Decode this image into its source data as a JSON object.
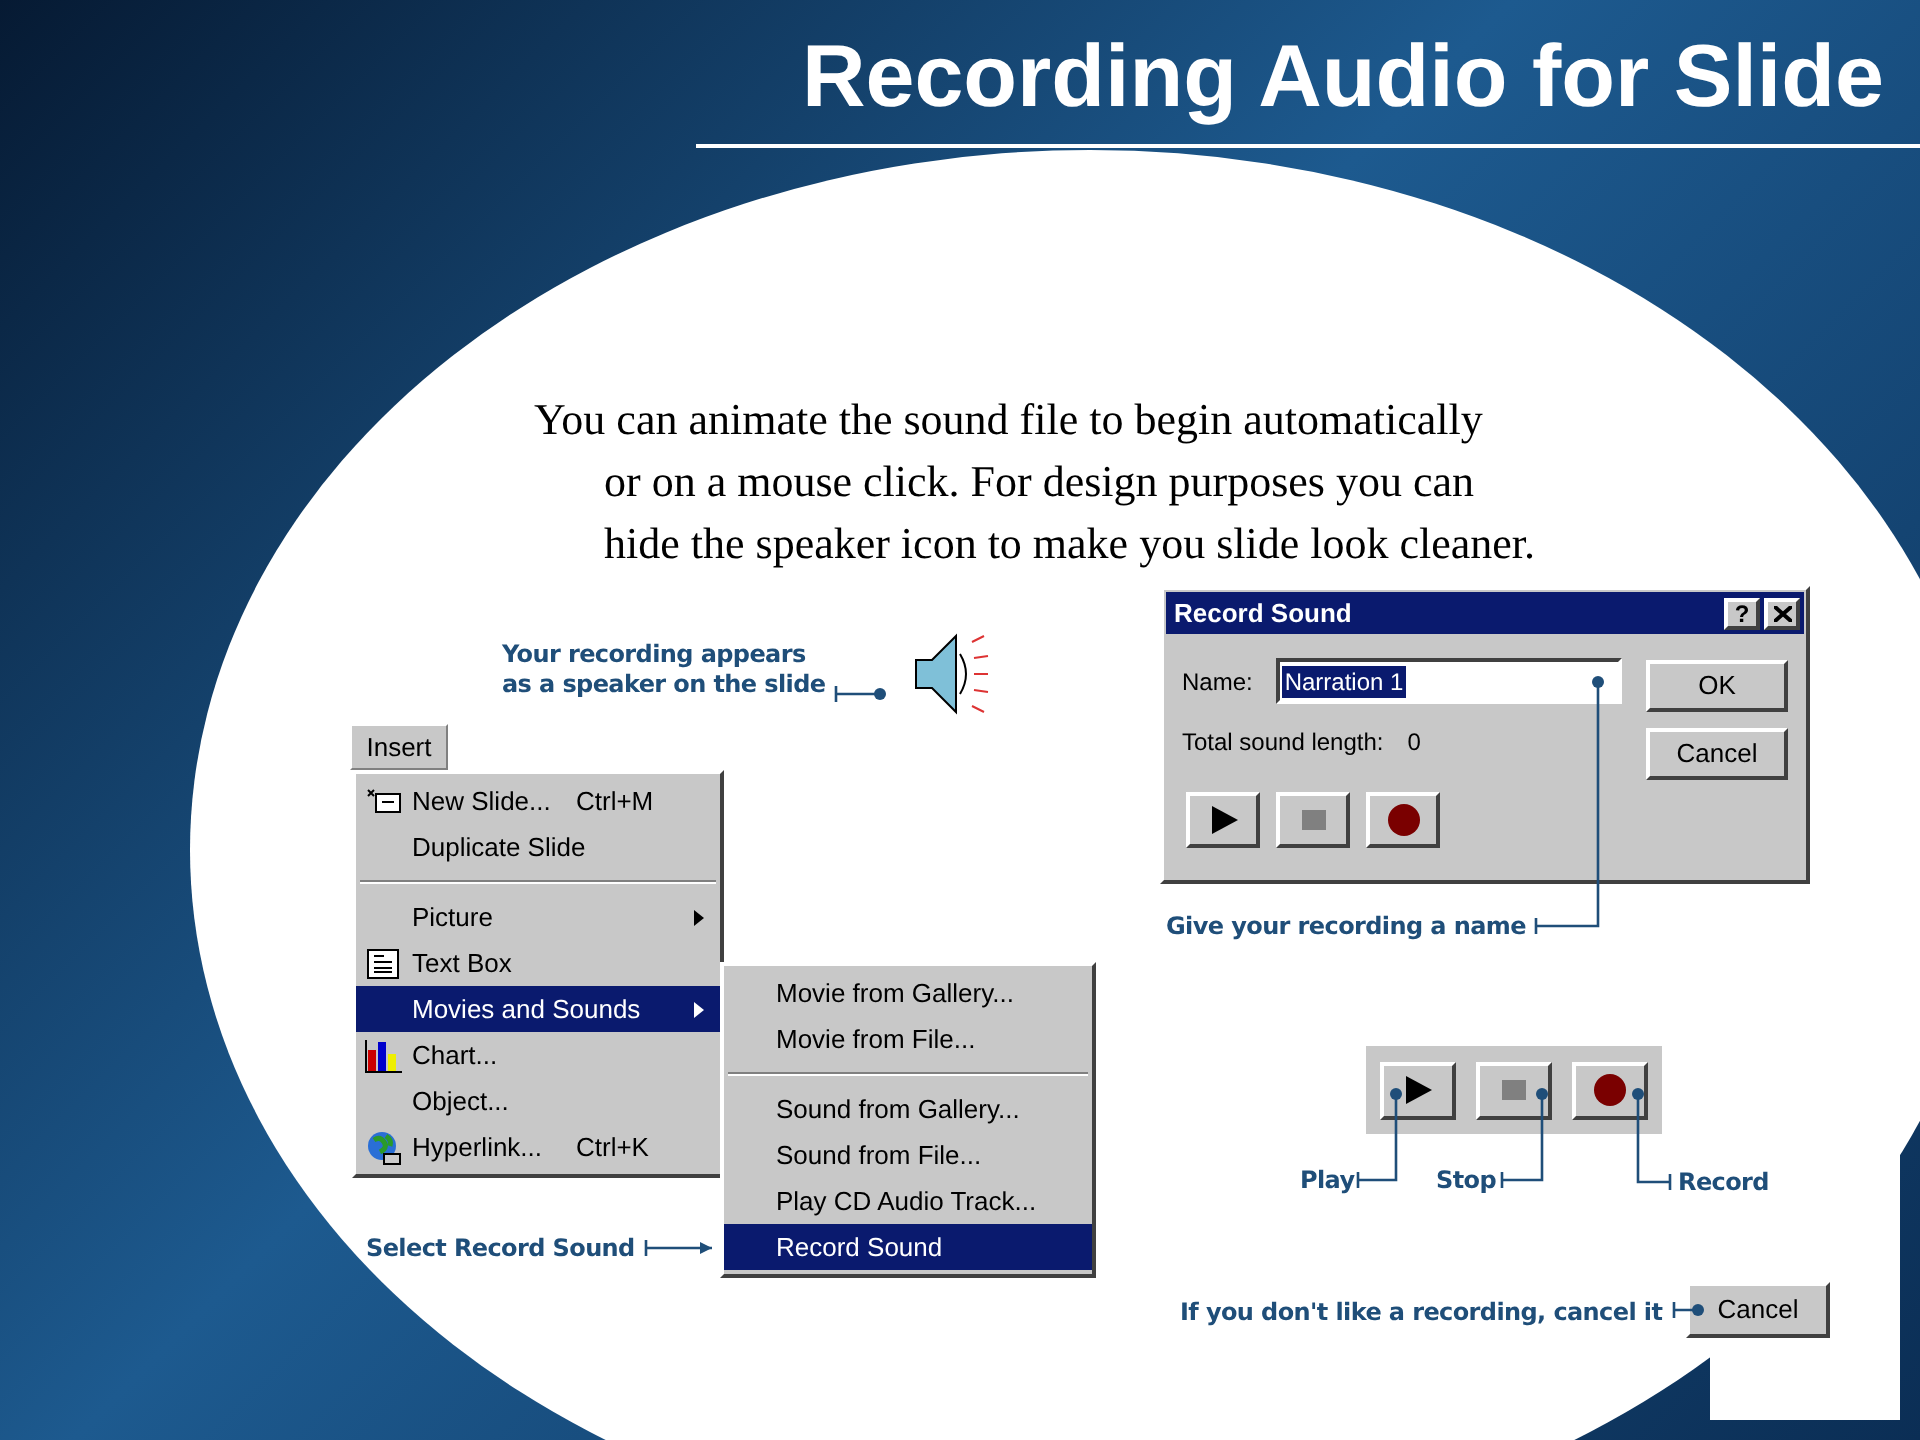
{
  "title": "Recording Audio for Slide",
  "body": [
    "You can animate the sound file to begin automatically",
    "or on a mouse click.  For design purposes you can",
    "hide the speaker icon to make you slide look cleaner."
  ],
  "speaker_callout": [
    "Your recording appears",
    "as a speaker  on the slide"
  ],
  "insert_menu": {
    "button": "Insert",
    "items": [
      {
        "kind": "item",
        "label": "New Slide...",
        "shortcut": "Ctrl+M",
        "submenu": false,
        "selected": false
      },
      {
        "kind": "item",
        "label": "Duplicate Slide",
        "submenu": false,
        "selected": false
      },
      {
        "kind": "separator"
      },
      {
        "kind": "item",
        "label": "Picture",
        "submenu": true,
        "selected": false
      },
      {
        "kind": "item",
        "label": "Text Box",
        "submenu": false,
        "selected": false
      },
      {
        "kind": "item",
        "label": "Movies and Sounds",
        "submenu": true,
        "selected": true
      },
      {
        "kind": "item",
        "label": "Chart...",
        "submenu": false,
        "selected": false
      },
      {
        "kind": "item",
        "label": "Object...",
        "submenu": false,
        "selected": false
      },
      {
        "kind": "item",
        "label": "Hyperlink...",
        "shortcut": "Ctrl+K",
        "submenu": false,
        "selected": false
      }
    ]
  },
  "submenu": {
    "items": [
      {
        "kind": "item",
        "label": "Movie from Gallery...",
        "selected": false
      },
      {
        "kind": "item",
        "label": "Movie from File...",
        "selected": false
      },
      {
        "kind": "separator"
      },
      {
        "kind": "item",
        "label": "Sound from Gallery...",
        "selected": false
      },
      {
        "kind": "item",
        "label": "Sound from File...",
        "selected": false
      },
      {
        "kind": "item",
        "label": "Play CD Audio Track...",
        "selected": false
      },
      {
        "kind": "item",
        "label": "Record Sound",
        "selected": true
      }
    ]
  },
  "menu_callout": "Select Record Sound",
  "record_dialog": {
    "title": "Record Sound",
    "help": "?",
    "name_label": "Name:",
    "name_value": "Narration 1",
    "length_label": "Total sound length:",
    "length_value": "0",
    "buttons": [
      "OK",
      "Cancel"
    ]
  },
  "dialog_callout": "Give your recording a name",
  "transport_labels": [
    "Play",
    "Stop",
    "Record"
  ],
  "cancel_callout": {
    "text": "If you don't like a recording, cancel it",
    "button": "Cancel"
  }
}
